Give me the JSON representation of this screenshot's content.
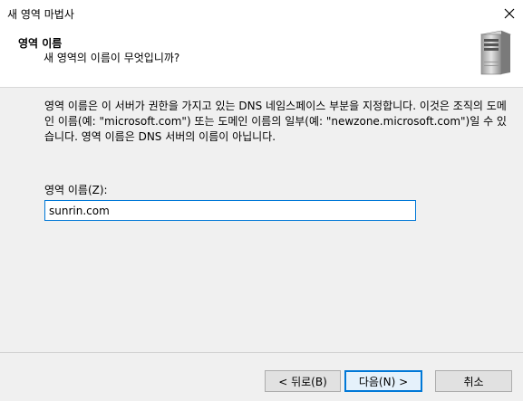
{
  "window": {
    "title": "새 영역 마법사",
    "close_icon": "close-icon"
  },
  "header": {
    "title": "영역 이름",
    "subtitle": "새 영역의 이름이 무엇입니까?",
    "icon": "server-icon"
  },
  "body": {
    "description": "영역 이름은 이 서버가 권한을 가지고 있는 DNS 네임스페이스 부분을 지정합니다. 이것은 조직의 도메인 이름(예: \"microsoft.com\") 또는 도메인 이름의 일부(예: \"newzone.microsoft.com\")일 수 있습니다. 영역 이름은 DNS 서버의 이름이 아닙니다.",
    "zone_label": "영역 이름(Z):",
    "zone_value": "sunrin.com"
  },
  "buttons": {
    "back": "< 뒤로(B)",
    "next": "다음(N) >",
    "cancel": "취소"
  },
  "colors": {
    "accent": "#0078d7",
    "header_bg": "#ffffff",
    "dialog_bg": "#f0f0f0"
  }
}
